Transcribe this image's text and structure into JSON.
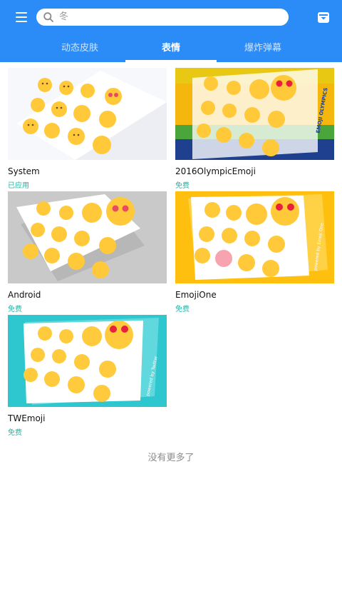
{
  "search": {
    "placeholder": "冬"
  },
  "tabs": [
    {
      "label": "动态皮肤",
      "active": false
    },
    {
      "label": "表情",
      "active": true
    },
    {
      "label": "爆炸弹幕",
      "active": false
    }
  ],
  "packs": [
    {
      "title": "System",
      "status": "已应用",
      "thumb_bg": "#f7f8fb"
    },
    {
      "title": "2016OlympicEmoji",
      "status": "免费",
      "thumb_bg": "#f5b70d",
      "thumb_caption": "EMOJI OLYMPICS"
    },
    {
      "title": "Android",
      "status": "免费",
      "thumb_bg": "#c9c9c9"
    },
    {
      "title": "EmojiOne",
      "status": "免费",
      "thumb_bg": "#ffbf0f",
      "thumb_caption": "powered by Emoji One"
    },
    {
      "title": "TWEmoji",
      "status": "免费",
      "thumb_bg": "#2ec6cf",
      "thumb_caption": "powered by Twitter"
    }
  ],
  "footer": {
    "no_more": "没有更多了"
  },
  "colors": {
    "header": "#2b8cf8",
    "status": "#24b3a4",
    "emoji": "#ffc93a"
  },
  "icons": {
    "menu": "menu-icon",
    "search": "search-icon",
    "store": "store-icon"
  }
}
